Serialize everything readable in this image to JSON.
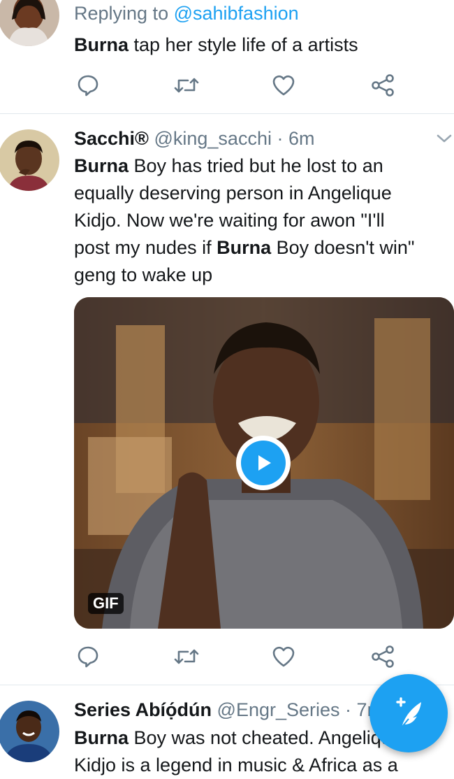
{
  "tweets": [
    {
      "reply_prefix": "Replying to ",
      "reply_handle": "@sahibfashion",
      "text_bold": "Burna",
      "text_rest": " tap her style life of a artists"
    },
    {
      "name": "Sacchi®",
      "handle": "@king_sacchi",
      "separator": " · ",
      "time": "6m",
      "lines": [
        {
          "bold": "Burna",
          "text": " Boy has tried but he lost to an"
        },
        {
          "bold": "",
          "text": "equally deserving person in Angelique"
        },
        {
          "bold": "",
          "text": "Kidjo. Now we're waiting for awon \"I'll"
        },
        {
          "pre": "post my nudes if ",
          "bold": "Burna",
          "text": " Boy doesn't win\""
        },
        {
          "bold": "",
          "text": "geng to wake up"
        }
      ],
      "media": {
        "badge": "GIF"
      }
    },
    {
      "name": "Series Abíọ́dún",
      "handle": "@Engr_Series",
      "separator": " · ",
      "time": "7m",
      "lines": [
        {
          "bold": "Burna",
          "text": " Boy was not cheated. Angelique"
        },
        {
          "bold": "",
          "text": "Kidjo is a legend in music & Africa as a"
        }
      ]
    }
  ],
  "icons": {
    "reply": "reply-icon",
    "retweet": "retweet-icon",
    "like": "heart-icon",
    "share": "share-icon",
    "compose": "compose-feather-icon"
  },
  "colors": {
    "accent": "#1da1f2",
    "muted": "#657786",
    "divider": "#e1e8ed"
  }
}
